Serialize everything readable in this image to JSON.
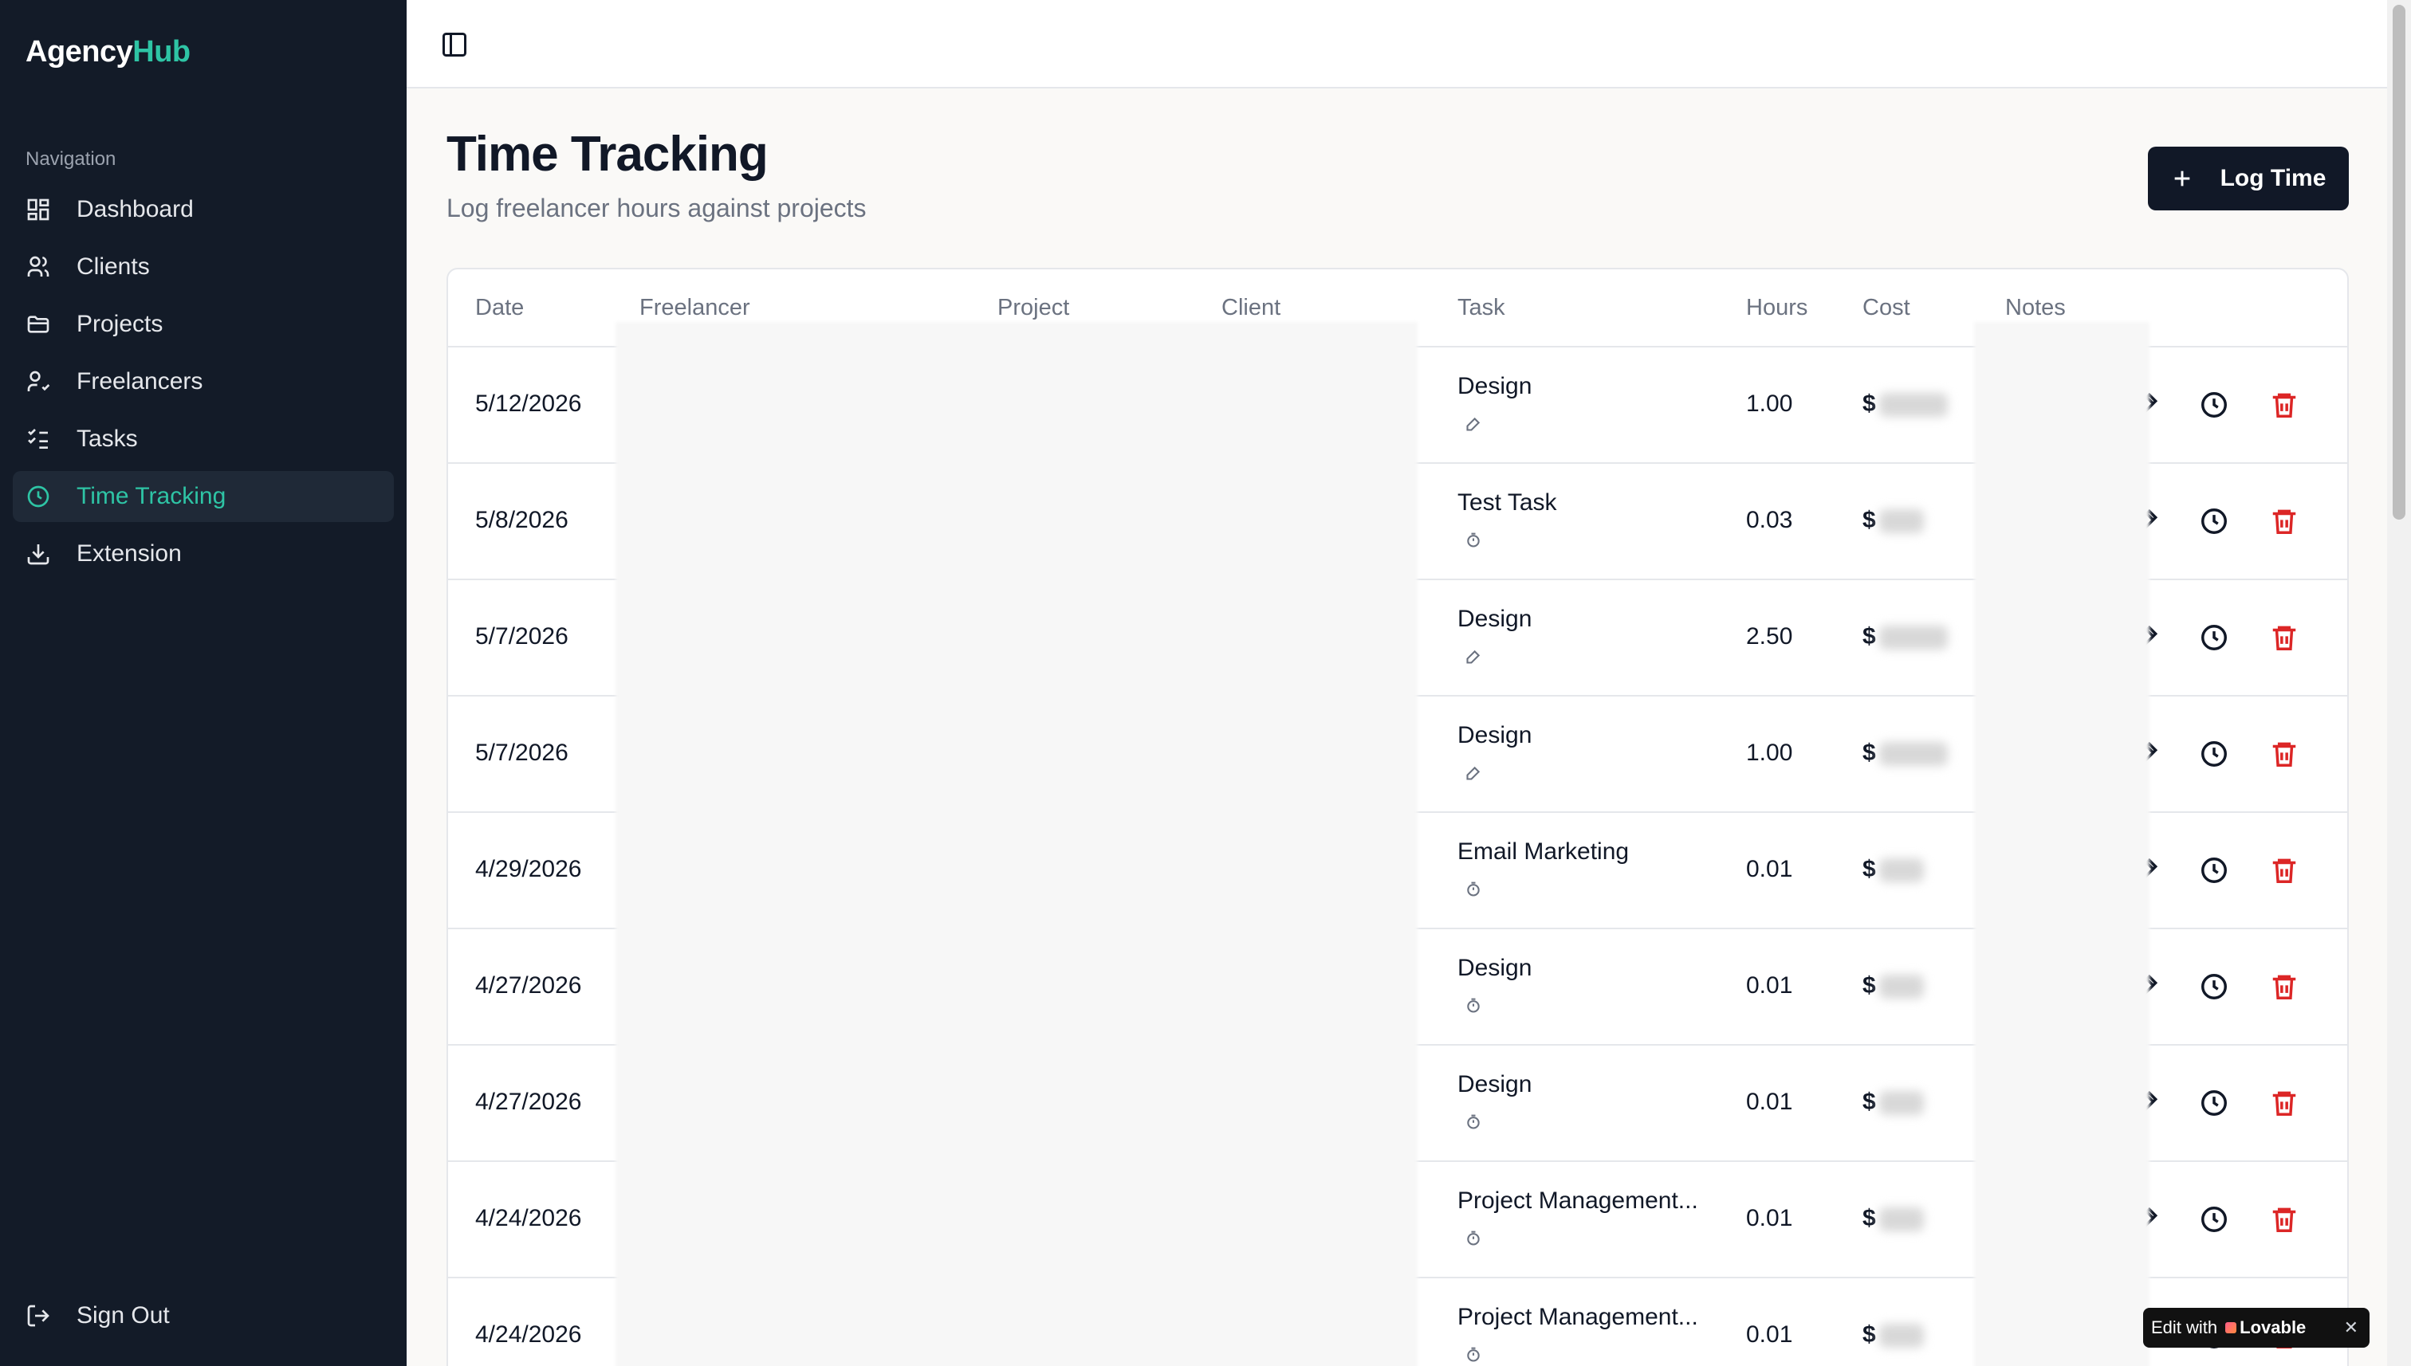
{
  "app": {
    "logo_main": "Agency",
    "logo_accent": "Hub",
    "accent_color": "#2ec4a5",
    "sidebar_bg": "#131b28"
  },
  "sidebar": {
    "heading": "Navigation",
    "items": [
      {
        "label": "Dashboard",
        "icon": "grid-icon"
      },
      {
        "label": "Clients",
        "icon": "users-icon"
      },
      {
        "label": "Projects",
        "icon": "folder-icon"
      },
      {
        "label": "Freelancers",
        "icon": "user-check-icon"
      },
      {
        "label": "Tasks",
        "icon": "list-checks-icon"
      },
      {
        "label": "Time Tracking",
        "icon": "clock-icon",
        "active": true
      },
      {
        "label": "Extension",
        "icon": "download-icon"
      }
    ],
    "signout": "Sign Out"
  },
  "page": {
    "title": "Time Tracking",
    "subtitle": "Log freelancer hours against projects",
    "log_button": "Log Time"
  },
  "table": {
    "columns": [
      "Date",
      "Freelancer",
      "Project",
      "Client",
      "Task",
      "Hours",
      "Cost",
      "Notes"
    ],
    "rows": [
      {
        "date": "5/12/2026",
        "task": "Design",
        "task_icon": "pencil-icon",
        "hours": "1.00",
        "cost_prefix": "$"
      },
      {
        "date": "5/8/2026",
        "task": "Test Task",
        "task_icon": "timer-icon",
        "hours": "0.03",
        "cost_prefix": "$"
      },
      {
        "date": "5/7/2026",
        "task": "Design",
        "task_icon": "pencil-icon",
        "hours": "2.50",
        "cost_prefix": "$"
      },
      {
        "date": "5/7/2026",
        "task": "Design",
        "task_icon": "pencil-icon",
        "hours": "1.00",
        "cost_prefix": "$"
      },
      {
        "date": "4/29/2026",
        "task": "Email Marketing",
        "task_icon": "timer-icon",
        "hours": "0.01",
        "cost_prefix": "$"
      },
      {
        "date": "4/27/2026",
        "task": "Design",
        "task_icon": "timer-icon",
        "hours": "0.01",
        "cost_prefix": "$"
      },
      {
        "date": "4/27/2026",
        "task": "Design",
        "task_icon": "timer-icon",
        "hours": "0.01",
        "cost_prefix": "$"
      },
      {
        "date": "4/24/2026",
        "task": "Project Management...",
        "task_icon": "timer-icon",
        "hours": "0.01",
        "cost_prefix": "$"
      },
      {
        "date": "4/24/2026",
        "task": "Project Management...",
        "task_icon": "timer-icon",
        "hours": "0.01",
        "cost_prefix": "$"
      }
    ]
  },
  "badge": {
    "prefix": "Edit with",
    "brand": "Lovable",
    "close": "✕"
  }
}
